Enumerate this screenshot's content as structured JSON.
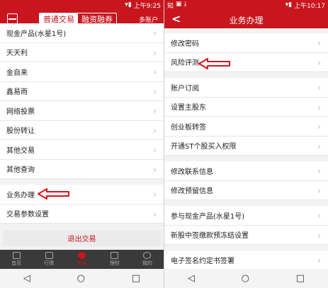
{
  "left": {
    "status": {
      "time": "上午9:25"
    },
    "segment": {
      "active": "普通交易",
      "inactive": "融资融券"
    },
    "account": "多账户",
    "items": [
      {
        "label": "现金产品(水星1号)"
      },
      {
        "label": "天天利"
      },
      {
        "label": "金自来"
      },
      {
        "label": "鑫易雨"
      },
      {
        "label": "网络投票"
      },
      {
        "label": "股份转让"
      },
      {
        "label": "其他交易"
      },
      {
        "label": "其他查询"
      },
      {
        "label": "业务办理"
      },
      {
        "label": "交易参数设置"
      }
    ],
    "logout": "退出交易",
    "tabs": [
      {
        "label": "首页"
      },
      {
        "label": "行情"
      },
      {
        "label": "交易"
      },
      {
        "label": "理财"
      },
      {
        "label": "我的"
      }
    ]
  },
  "right": {
    "status": {
      "time": "上午10:17",
      "left_text": "知"
    },
    "title": "业务办理",
    "groups": [
      [
        {
          "label": "修改密码"
        },
        {
          "label": "风险评测"
        }
      ],
      [
        {
          "label": "账户订阅"
        },
        {
          "label": "设置主股东"
        },
        {
          "label": "创业板转签"
        },
        {
          "label": "开通ST个股买入权限"
        }
      ],
      [
        {
          "label": "修改联系信息"
        },
        {
          "label": "修改预留信息"
        }
      ],
      [
        {
          "label": "参与现金产品(水星1号)"
        },
        {
          "label": "新股中签缴款预冻结设置"
        }
      ],
      [
        {
          "label": "电子签名约定书签署"
        }
      ]
    ]
  },
  "nav": {
    "back": "◁",
    "home": "○",
    "recent": "□"
  },
  "colors": {
    "brand": "#c9151e"
  }
}
